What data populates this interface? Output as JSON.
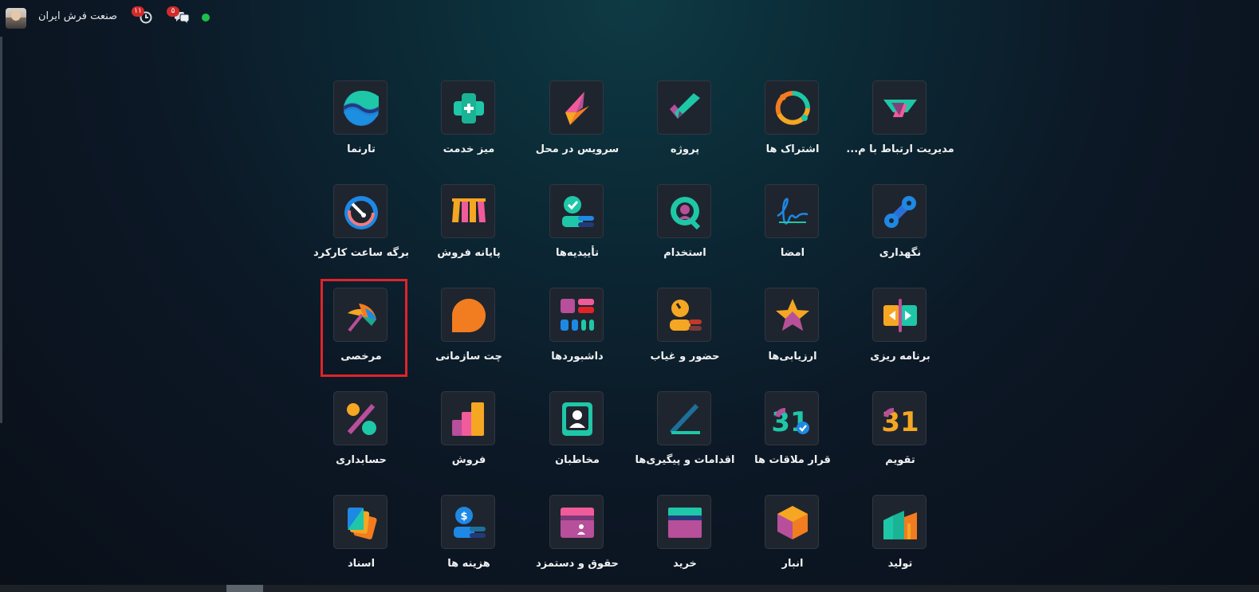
{
  "header": {
    "company_name": "صنعت فرش ایران",
    "activity_badge": "۱۱",
    "messages_badge": "۵",
    "status": "online"
  },
  "apps": [
    {
      "label": "مدیریت ارتباط با م...",
      "icon": "crm-icon"
    },
    {
      "label": "اشتراک ها",
      "icon": "subscriptions-icon"
    },
    {
      "label": "پروژه",
      "icon": "project-icon"
    },
    {
      "label": "سرویس در محل",
      "icon": "field-service-icon"
    },
    {
      "label": "میز خدمت",
      "icon": "helpdesk-icon"
    },
    {
      "label": "تارنما",
      "icon": "website-icon"
    },
    {
      "label": "نگهداری",
      "icon": "maintenance-icon"
    },
    {
      "label": "امضا",
      "icon": "sign-icon"
    },
    {
      "label": "استخدام",
      "icon": "recruitment-icon"
    },
    {
      "label": "تأییدیه‌ها",
      "icon": "approvals-icon"
    },
    {
      "label": "پایانه فروش",
      "icon": "point-of-sale-icon"
    },
    {
      "label": "برگه ساعت کارکرد",
      "icon": "timesheets-icon"
    },
    {
      "label": "برنامه ریزی",
      "icon": "planning-icon"
    },
    {
      "label": "ارزیابی‌ها",
      "icon": "appraisals-icon"
    },
    {
      "label": "حضور و غیاب",
      "icon": "attendances-icon"
    },
    {
      "label": "داشبوردها",
      "icon": "dashboards-icon"
    },
    {
      "label": "چت سازمانی",
      "icon": "discuss-icon"
    },
    {
      "label": "مرخصی",
      "icon": "time-off-icon"
    },
    {
      "label": "تقویم",
      "icon": "calendar-icon"
    },
    {
      "label": "قرار ملاقات ها",
      "icon": "appointments-icon"
    },
    {
      "label": "اقدامات و پیگیری‌ها",
      "icon": "activities-icon"
    },
    {
      "label": "مخاطبان",
      "icon": "contacts-icon"
    },
    {
      "label": "فروش",
      "icon": "sales-icon"
    },
    {
      "label": "حسابداری",
      "icon": "accounting-icon"
    },
    {
      "label": "تولید",
      "icon": "manufacturing-icon"
    },
    {
      "label": "انبار",
      "icon": "inventory-icon"
    },
    {
      "label": "خرید",
      "icon": "purchase-icon"
    },
    {
      "label": "حقوق و دستمزد",
      "icon": "payroll-icon"
    },
    {
      "label": "هزینه ها",
      "icon": "expenses-icon"
    },
    {
      "label": "اسناد",
      "icon": "documents-icon"
    }
  ],
  "calendar_icon_text": "31",
  "highlighted_app": "مرخصی"
}
